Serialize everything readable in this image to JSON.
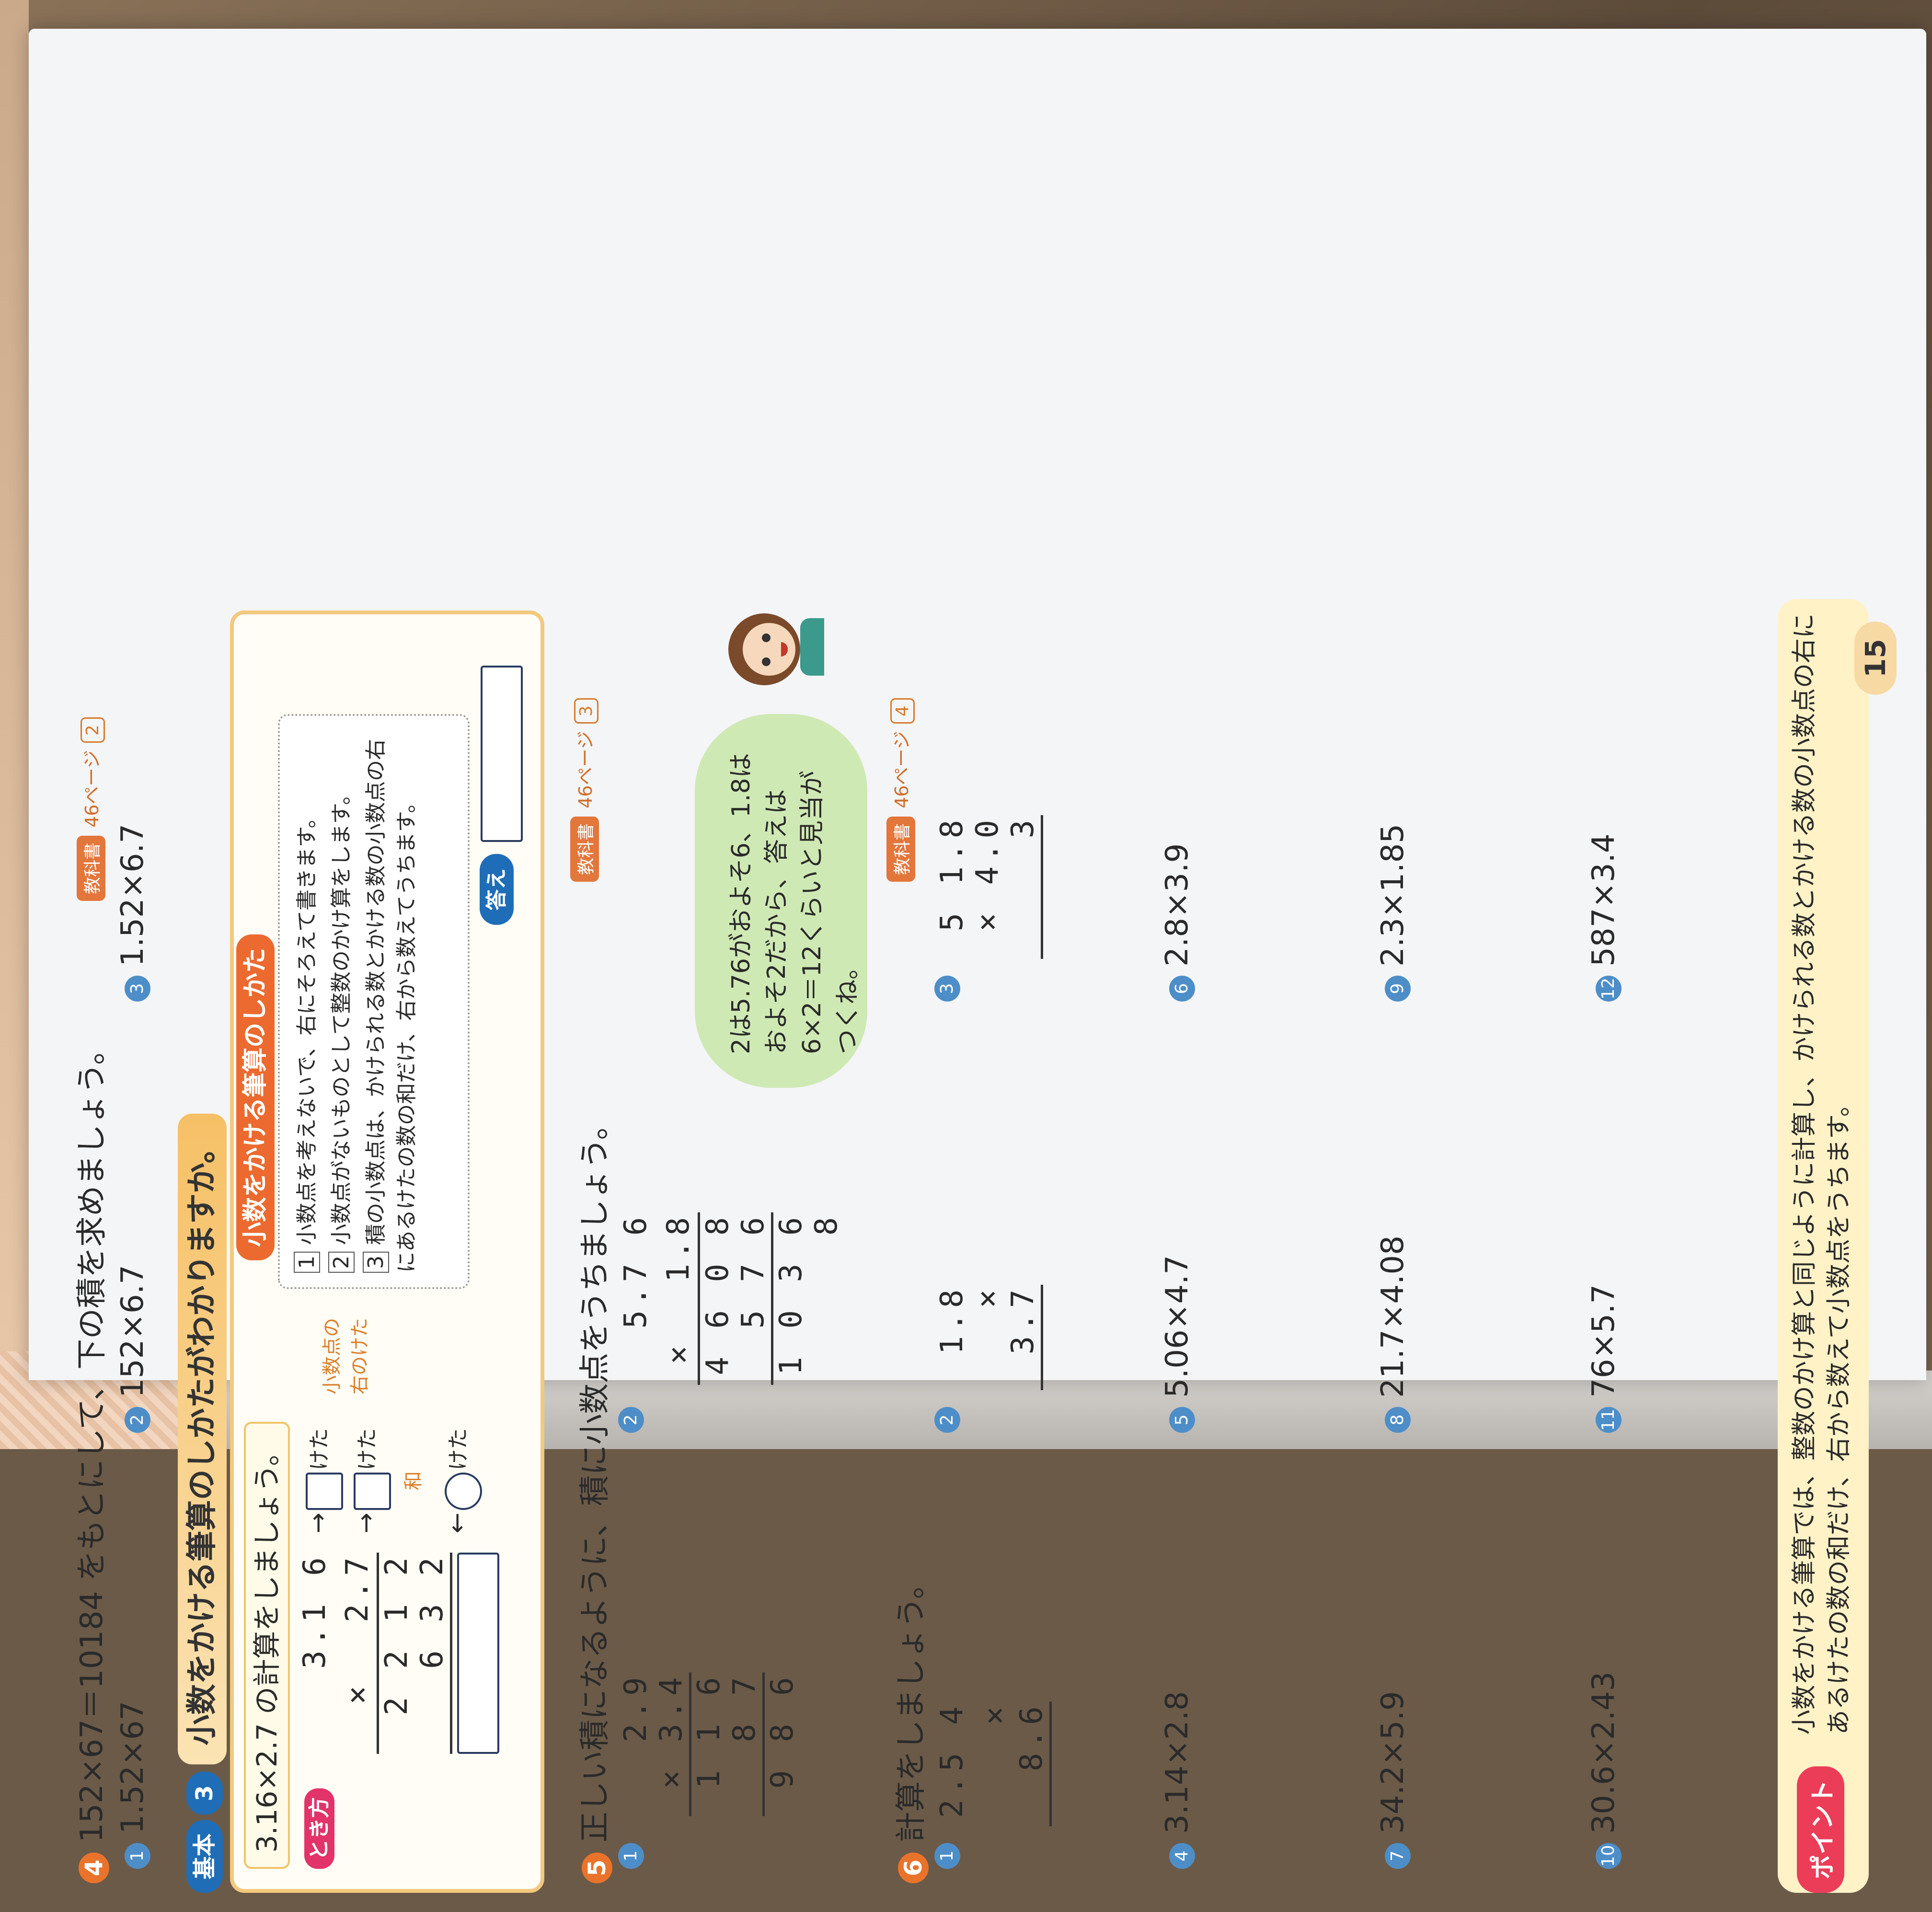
{
  "q4": {
    "number": "4",
    "prompt": "152×67＝10184 をもとにして、下の積を求めましょう。",
    "items": [
      {
        "no": "1",
        "expr": "1.52×67"
      },
      {
        "no": "2",
        "expr": "152×6.7"
      },
      {
        "no": "3",
        "expr": "1.52×6.7"
      }
    ],
    "kyokasho": "教科書",
    "page_ref": "46ページ",
    "ref_tag": "2"
  },
  "kihon": {
    "badge": "基本",
    "number": "3",
    "title": "小数をかける筆算のしかたがわかりますか。",
    "problem": "3.16×2.7 の計算をしましょう。",
    "tokikata": "とき方",
    "calc_rows": [
      "3.1 6",
      "×　 2.7",
      "2 2 1 2",
      "6 3 2"
    ],
    "keta_label": "けた",
    "keta_note": "小数点の右のけた",
    "wa_label": "和",
    "shikata_title": "小数をかける筆算のしかた",
    "steps": [
      {
        "no": "1",
        "text": "小数点を考えないで、右にそろえて書きます。"
      },
      {
        "no": "2",
        "text": "小数点がないものとして整数のかけ算をします。"
      },
      {
        "no": "3",
        "text": "積の小数点は、かけられる数とかける数の小数点の右にあるけたの数の和だけ、右から数えてうちます。"
      }
    ],
    "answer_label": "答え"
  },
  "q5": {
    "number": "5",
    "prompt": "正しい積になるように、積に小数点をうちましょう。",
    "kyokasho": "教科書",
    "page_ref": "46ページ",
    "ref_tag": "3",
    "p1_no": "1",
    "p1_rows": [
      "2.9",
      "× 3.4",
      "1 1 6",
      "8 7",
      "9 8 6"
    ],
    "p2_no": "2",
    "p2_rows": [
      "5.7 6",
      "×　 1.8",
      "4 6 0 8",
      "5 7 6",
      "1 0 3 6 8"
    ],
    "bubble": "2は5.76がおよそ6、1.8はおよそ2だから、答えは6×2＝12くらいと見当がつくね。"
  },
  "q6": {
    "number": "6",
    "prompt": "計算をしましょう。",
    "kyokasho": "教科書",
    "page_ref": "46ページ",
    "ref_tag": "4",
    "vertical": [
      {
        "no": "1",
        "top": "2.5 4",
        "bottom": "×　8.6"
      },
      {
        "no": "2",
        "top": "1.8",
        "bottom": "× 3.7"
      },
      {
        "no": "3",
        "top": "5 1.8",
        "bottom": "× 4.0 3"
      }
    ],
    "rows": [
      [
        {
          "no": "4",
          "expr": "3.14×2.8"
        },
        {
          "no": "5",
          "expr": "5.06×4.7"
        },
        {
          "no": "6",
          "expr": "2.8×3.9"
        }
      ],
      [
        {
          "no": "7",
          "expr": "34.2×5.9"
        },
        {
          "no": "8",
          "expr": "21.7×4.08"
        },
        {
          "no": "9",
          "expr": "2.3×1.85"
        }
      ],
      [
        {
          "no": "10",
          "expr": "30.6×2.43"
        },
        {
          "no": "11",
          "expr": "76×5.7"
        },
        {
          "no": "12",
          "expr": "587×3.4"
        }
      ]
    ]
  },
  "point": {
    "badge": "ポイント",
    "text": "小数をかける筆算では、整数のかけ算と同じように計算し、かけられる数とかける数の小数点の右にあるけたの数の和だけ、右から数えて小数点をうちます。"
  },
  "page_number": "15"
}
